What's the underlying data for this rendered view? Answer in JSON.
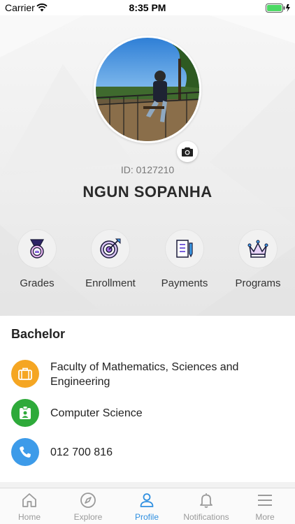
{
  "status_bar": {
    "carrier": "Carrier",
    "time": "8:35 PM"
  },
  "profile": {
    "id_text": "ID: 0127210",
    "name": "NGUN SOPANHA"
  },
  "menu": [
    {
      "label": "Grades",
      "icon": "medal-icon"
    },
    {
      "label": "Enrollment",
      "icon": "target-icon"
    },
    {
      "label": "Payments",
      "icon": "invoice-icon"
    },
    {
      "label": "Programs",
      "icon": "crown-icon"
    }
  ],
  "details": {
    "title": "Bachelor",
    "faculty": "Faculty of Mathematics, Sciences and Engineering",
    "major": "Computer Science",
    "phone": "012 700 816"
  },
  "colors": {
    "faculty_icon": "#f5a623",
    "major_icon": "#2eaa3a",
    "phone_icon": "#3d9be9",
    "active_tab": "#2f8fe0",
    "inactive_tab": "#9a9a9a"
  },
  "tabs": [
    {
      "label": "Home",
      "icon": "home-icon"
    },
    {
      "label": "Explore",
      "icon": "compass-icon"
    },
    {
      "label": "Profile",
      "icon": "person-icon",
      "active": true
    },
    {
      "label": "Notifications",
      "icon": "bell-icon"
    },
    {
      "label": "More",
      "icon": "menu-icon"
    }
  ]
}
